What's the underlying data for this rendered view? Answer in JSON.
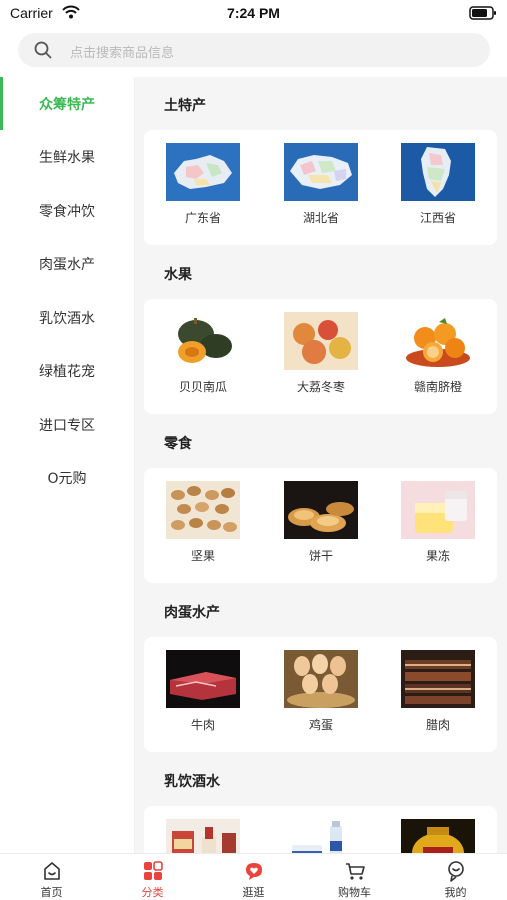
{
  "status_bar": {
    "carrier": "Carrier",
    "time": "7:24 PM"
  },
  "search": {
    "placeholder": "点击搜索商品信息"
  },
  "sidebar": {
    "items": [
      {
        "label": "众筹特产",
        "active": true
      },
      {
        "label": "生鲜水果"
      },
      {
        "label": "零食冲饮"
      },
      {
        "label": "肉蛋水产"
      },
      {
        "label": "乳饮酒水"
      },
      {
        "label": "绿植花宠"
      },
      {
        "label": "进口专区"
      },
      {
        "label": "O元购"
      }
    ]
  },
  "sections": [
    {
      "title": "土特产",
      "products": [
        {
          "name": "广东省"
        },
        {
          "name": "湖北省"
        },
        {
          "name": "江西省"
        }
      ]
    },
    {
      "title": "水果",
      "products": [
        {
          "name": "贝贝南瓜"
        },
        {
          "name": "大荔冬枣"
        },
        {
          "name": "赣南脐橙"
        }
      ]
    },
    {
      "title": "零食",
      "products": [
        {
          "name": "坚果"
        },
        {
          "name": "饼干"
        },
        {
          "name": "果冻"
        }
      ]
    },
    {
      "title": "肉蛋水产",
      "products": [
        {
          "name": "牛肉"
        },
        {
          "name": "鸡蛋"
        },
        {
          "name": "腊肉"
        }
      ]
    },
    {
      "title": "乳饮酒水",
      "products": [
        {
          "name": ""
        },
        {
          "name": ""
        },
        {
          "name": ""
        }
      ]
    }
  ],
  "tabbar": {
    "items": [
      {
        "label": "首页",
        "icon": "home-icon"
      },
      {
        "label": "分类",
        "icon": "category-icon",
        "active": true
      },
      {
        "label": "逛逛",
        "icon": "heart-chat-icon"
      },
      {
        "label": "购物车",
        "icon": "cart-icon"
      },
      {
        "label": "我的",
        "icon": "profile-icon"
      }
    ]
  },
  "colors": {
    "accent_green": "#3cba55",
    "accent_red": "#e9433c",
    "content_bg": "#f5f5f5"
  }
}
